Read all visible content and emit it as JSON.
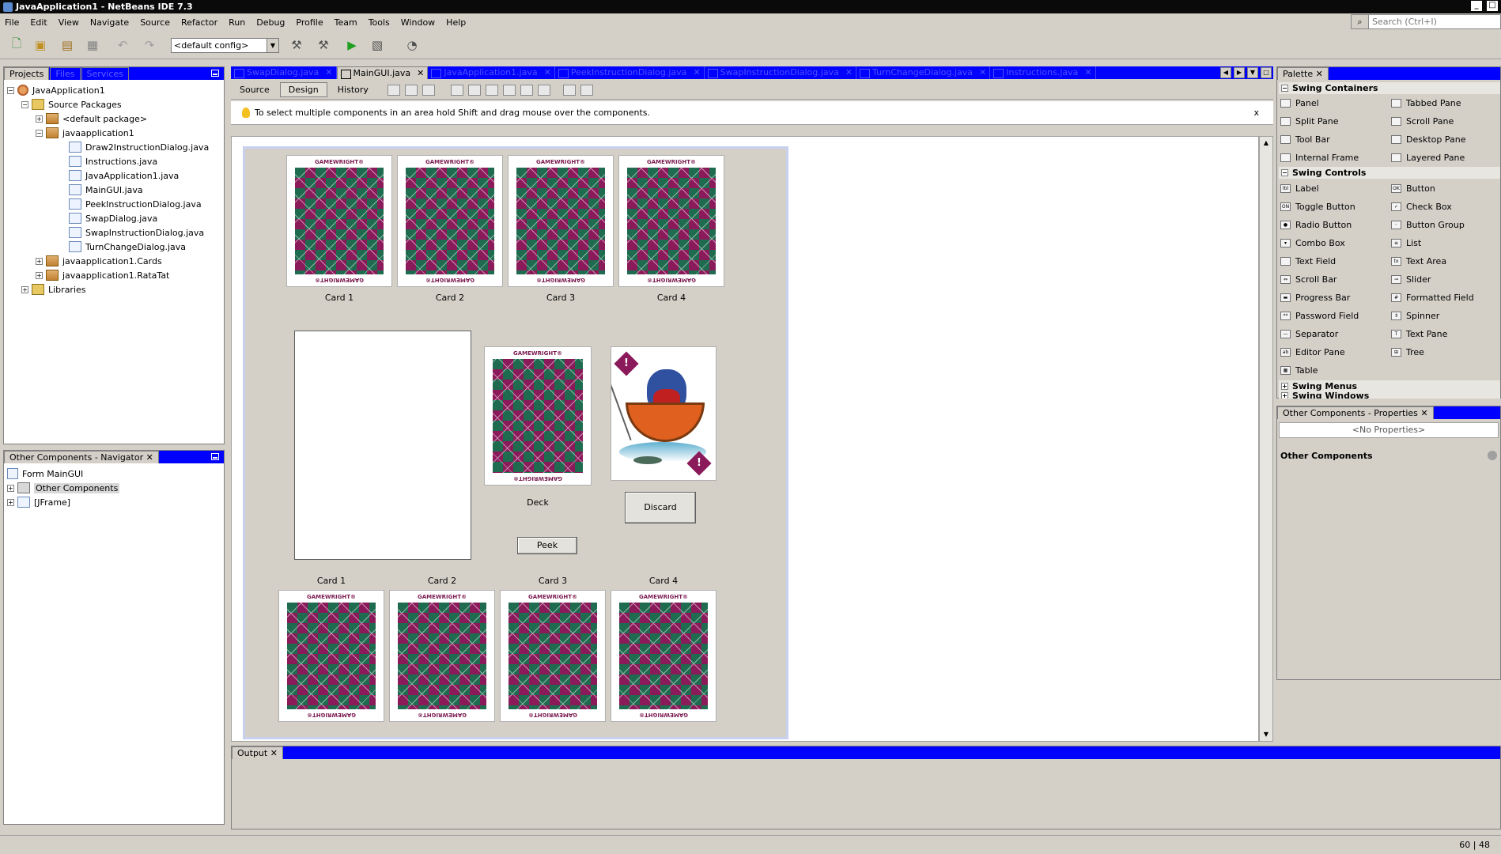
{
  "window": {
    "title": "JavaApplication1 - NetBeans IDE 7.3"
  },
  "menu": [
    "File",
    "Edit",
    "View",
    "Navigate",
    "Source",
    "Refactor",
    "Run",
    "Debug",
    "Profile",
    "Team",
    "Tools",
    "Window",
    "Help"
  ],
  "search": {
    "placeholder": "Search (Ctrl+I)"
  },
  "toolbar": {
    "config": "<default config>"
  },
  "projects_panel": {
    "tabs": [
      "Projects",
      "Files",
      "Services"
    ],
    "tree": [
      {
        "label": "JavaApplication1",
        "icon": "project-icon"
      },
      {
        "label": "Source Packages",
        "icon": "folder-icon"
      },
      {
        "label": "<default package>",
        "icon": "package-icon"
      },
      {
        "label": "javaapplication1",
        "icon": "package-icon"
      },
      {
        "label": "Draw2InstructionDialog.java",
        "icon": "java-file-icon"
      },
      {
        "label": "Instructions.java",
        "icon": "java-file-icon"
      },
      {
        "label": "JavaApplication1.java",
        "icon": "java-file-icon"
      },
      {
        "label": "MainGUI.java",
        "icon": "java-file-icon"
      },
      {
        "label": "PeekInstructionDialog.java",
        "icon": "java-file-icon"
      },
      {
        "label": "SwapDialog.java",
        "icon": "java-file-icon"
      },
      {
        "label": "SwapInstructionDialog.java",
        "icon": "java-file-icon"
      },
      {
        "label": "TurnChangeDialog.java",
        "icon": "java-file-icon"
      },
      {
        "label": "javaapplication1.Cards",
        "icon": "package-icon"
      },
      {
        "label": "javaapplication1.RataTat",
        "icon": "package-icon"
      },
      {
        "label": "Libraries",
        "icon": "library-icon"
      }
    ]
  },
  "navigator": {
    "tab": "Other Components - Navigator",
    "items": [
      "Form MainGUI",
      "Other Components",
      "[JFrame]"
    ]
  },
  "editor": {
    "tabs": [
      "SwapDialog.java",
      "MainGUI.java",
      "JavaApplication1.java",
      "PeekInstructionDialog.java",
      "SwapInstructionDialog.java",
      "TurnChangeDialog.java",
      "Instructions.java"
    ],
    "active_tab": "MainGUI.java",
    "views": [
      "Source",
      "Design",
      "History"
    ],
    "hint": "To select multiple components in an area hold Shift and drag mouse over the components.",
    "hint_close": "x"
  },
  "form": {
    "card_brand": "GAMEWRIGHT®",
    "top_labels": [
      "Card 1",
      "Card 2",
      "Card 3",
      "Card 4"
    ],
    "bottom_labels": [
      "Card 1",
      "Card 2",
      "Card 3",
      "Card 4"
    ],
    "deck_label": "Deck",
    "discard_button": "Discard",
    "peek_button": "Peek"
  },
  "palette": {
    "tab": "Palette",
    "sections": {
      "containers": "Swing Containers",
      "controls": "Swing Controls",
      "menus": "Swing Menus",
      "windows": "Swing Windows"
    },
    "containers": [
      "Panel",
      "Tabbed Pane",
      "Split Pane",
      "Scroll Pane",
      "Tool Bar",
      "Desktop Pane",
      "Internal Frame",
      "Layered Pane"
    ],
    "controls": [
      "Label",
      "Button",
      "Toggle Button",
      "Check Box",
      "Radio Button",
      "Button Group",
      "Combo Box",
      "List",
      "Text Field",
      "Text Area",
      "Scroll Bar",
      "Slider",
      "Progress Bar",
      "Formatted Field",
      "Password Field",
      "Spinner",
      "Separator",
      "Text Pane",
      "Editor Pane",
      "Tree",
      "Table"
    ]
  },
  "properties": {
    "tab": "Other Components - Properties",
    "empty": "<No Properties>",
    "heading": "Other Components"
  },
  "output": {
    "tab": "Output"
  },
  "status": {
    "position": "60 | 48"
  },
  "colors": {
    "tab_bar": "#0000ff",
    "chrome": "#d4d0c8",
    "card_magenta": "#8b1a5a",
    "card_green": "#1f6b4f"
  }
}
